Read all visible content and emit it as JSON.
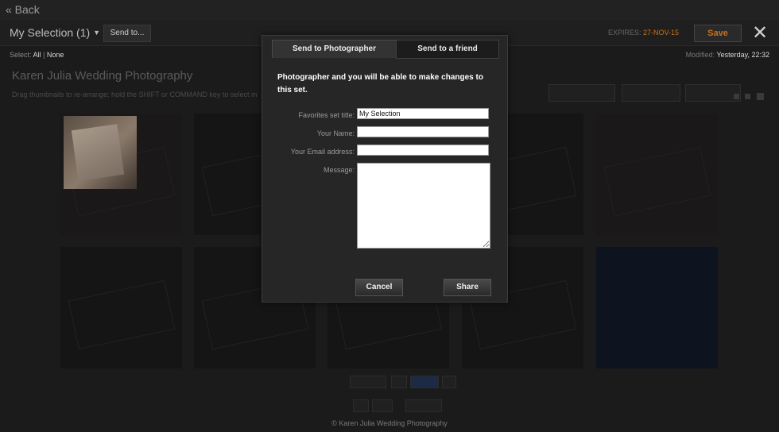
{
  "topbar": {
    "back_label": "« Back"
  },
  "toolbar": {
    "selection_title": "My Selection (1)",
    "send_to_label": "Send to...",
    "expires_label": "EXPIRES:",
    "expires_date": "27-NOV-15",
    "save_label": "Save"
  },
  "subbar": {
    "select_label": "Select:",
    "select_all": "All",
    "select_sep": "|",
    "select_none": "None",
    "modified_label": "Modified:",
    "modified_value": "Yesterday, 22:32"
  },
  "gallery": {
    "title": "Karen Julia Wedding Photography",
    "hint": "Drag thumbnails to re-arrange; hold the SHIFT or COMMAND key to select m"
  },
  "footer": {
    "copyright": "© Karen Julia Wedding Photography"
  },
  "modal": {
    "tabs": [
      {
        "label": "Send to Photographer",
        "active": true
      },
      {
        "label": "Send to a friend",
        "active": false
      }
    ],
    "intro": "Photographer and you will be able to make changes to this set.",
    "fields": {
      "favorites_label": "Favorites set title:",
      "favorites_value": "My Selection",
      "name_label": "Your Name:",
      "name_value": "",
      "email_label": "Your Email address:",
      "email_value": "",
      "message_label": "Message:",
      "message_value": ""
    },
    "cancel_label": "Cancel",
    "share_label": "Share"
  },
  "colors": {
    "accent": "#c7721f",
    "background": "#1b1b1b"
  },
  "icons": {
    "close": "close-icon",
    "caret": "chevron-down-icon"
  }
}
